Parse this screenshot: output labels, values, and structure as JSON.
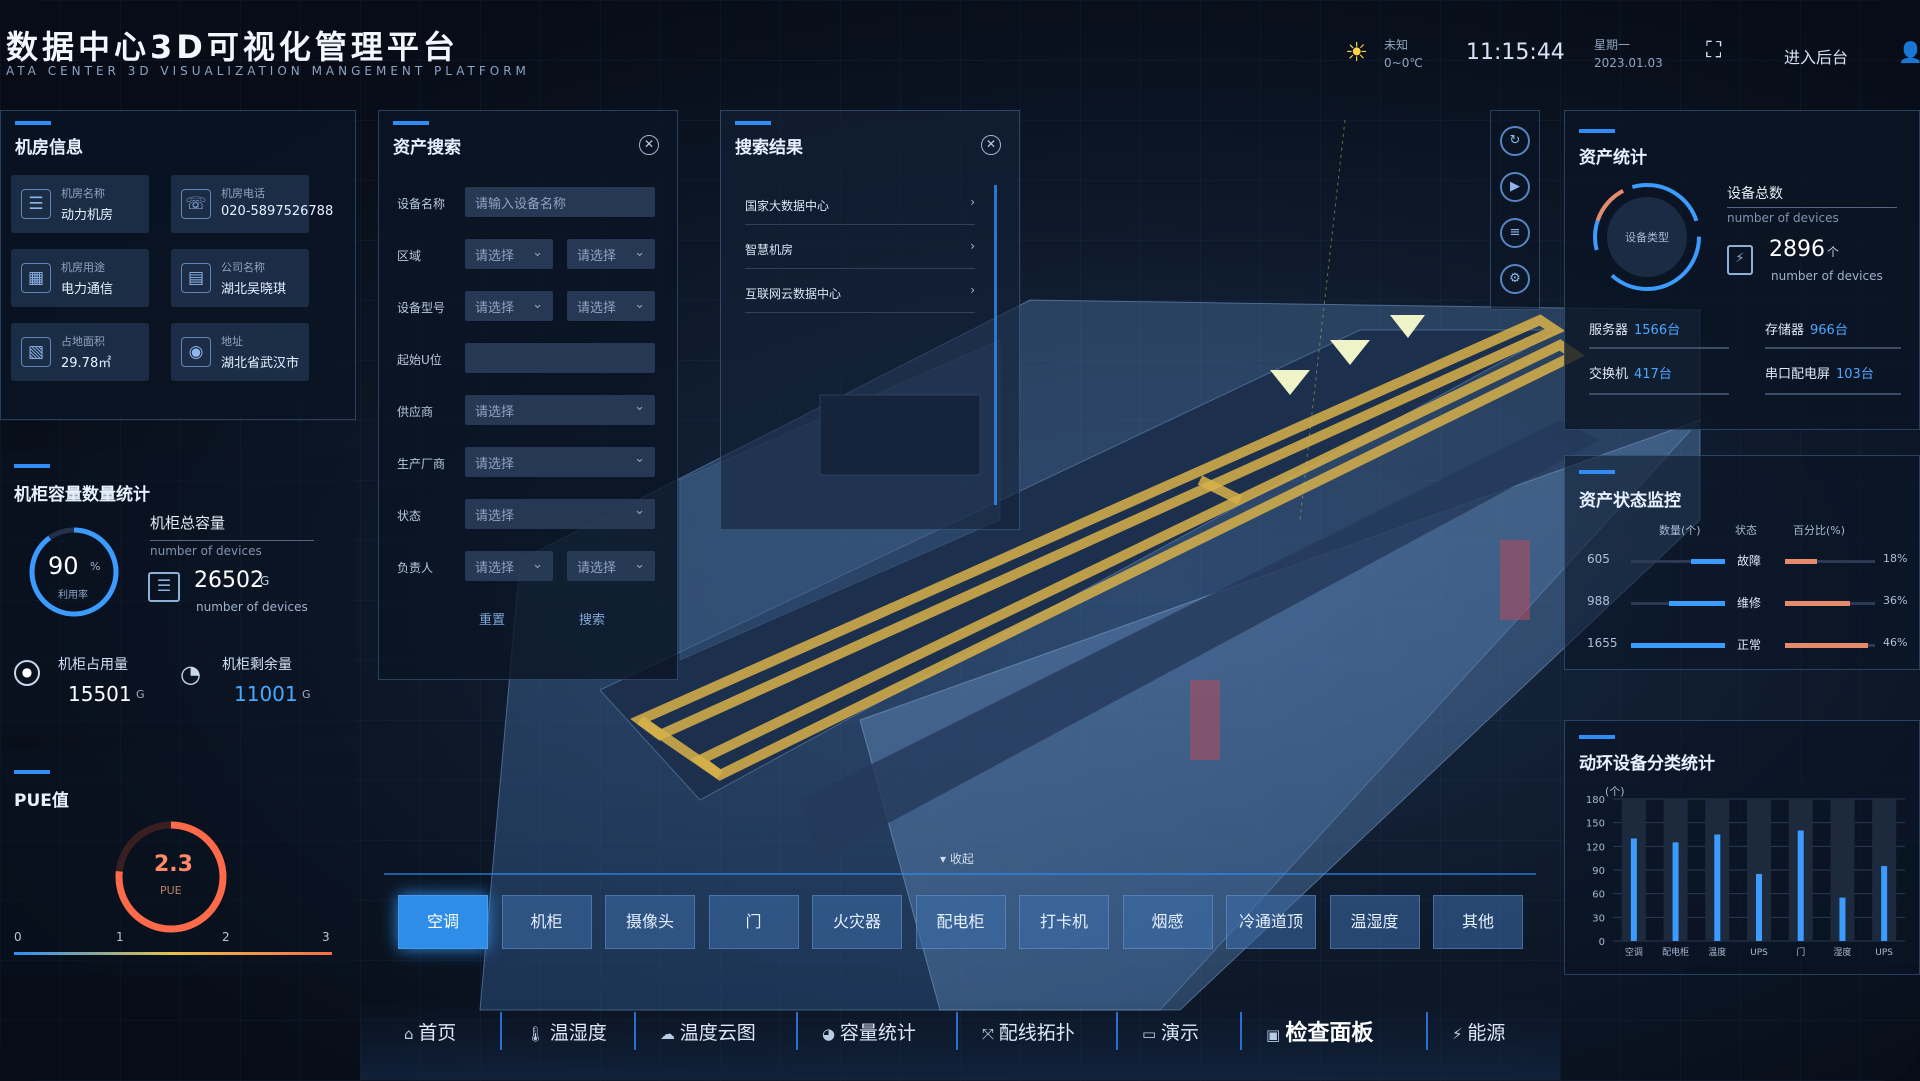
{
  "header": {
    "title": "数据中心3D可视化管理平台",
    "subtitle": "ATA CENTER 3D VISUALIZATION MANGEMENT PLATFORM",
    "weather": "未知",
    "temp": "0~0℃",
    "time": "11:15:44",
    "weekday": "星期一",
    "date": "2023.01.03",
    "enter_admin": "进入后台"
  },
  "room_info": {
    "title": "机房信息",
    "cards": [
      {
        "label": "机房名称",
        "value": "动力机房",
        "icon": "server-icon"
      },
      {
        "label": "机房电话",
        "value": "020-5897526788",
        "icon": "phone-icon"
      },
      {
        "label": "机房用途",
        "value": "电力通信",
        "icon": "grid-icon"
      },
      {
        "label": "公司名称",
        "value": "湖北吴晓琪",
        "icon": "building-icon"
      },
      {
        "label": "占地面积",
        "value": "29.78㎡",
        "icon": "area-icon"
      },
      {
        "label": "地址",
        "value": "湖北省武汉市",
        "icon": "location-icon"
      }
    ]
  },
  "cabinet_stats": {
    "title": "机柜容量数量统计",
    "gauge_value": "90",
    "gauge_unit": "%",
    "gauge_label": "利用率",
    "total_label": "机柜总容量",
    "total_sub": "number of devices",
    "total_value": "26502",
    "total_unit": "G",
    "total_value_sub": "number of devices",
    "used_label": "机柜占用量",
    "used_value": "15501",
    "used_unit": "G",
    "remain_label": "机柜剩余量",
    "remain_value": "11001",
    "remain_unit": "G"
  },
  "pue": {
    "title": "PUE值",
    "value": "2.3",
    "label": "PUE",
    "axis": [
      "0",
      "1",
      "2",
      "3"
    ]
  },
  "asset_search": {
    "title": "资产搜索",
    "fields": [
      {
        "label": "设备名称",
        "values": [
          "请输入设备名称"
        ]
      },
      {
        "label": "区域",
        "values": [
          "请选择",
          "请选择"
        ]
      },
      {
        "label": "设备型号",
        "values": [
          "请选择",
          "请选择"
        ]
      },
      {
        "label": "起始U位",
        "values": [
          ""
        ]
      },
      {
        "label": "供应商",
        "values": [
          "请选择"
        ]
      },
      {
        "label": "生产厂商",
        "values": [
          "请选择"
        ]
      },
      {
        "label": "状态",
        "values": [
          "请选择"
        ]
      },
      {
        "label": "负责人",
        "values": [
          "请选择",
          "请选择"
        ]
      }
    ],
    "reset": "重置",
    "search": "搜索"
  },
  "search_results": {
    "title": "搜索结果",
    "items": [
      "国家大数据中心",
      "智慧机房",
      "互联网云数据中心"
    ]
  },
  "asset_stats": {
    "title": "资产统计",
    "ring_label": "设备类型",
    "total_label": "设备总数",
    "total_sub": "number of devices",
    "total_value": "2896",
    "total_unit": "个",
    "total_value_sub": "number of devices",
    "items": [
      {
        "label": "服务器",
        "value": "1566台"
      },
      {
        "label": "存储器",
        "value": "966台"
      },
      {
        "label": "交换机",
        "value": "417台"
      },
      {
        "label": "串口配电屏",
        "value": "103台"
      }
    ]
  },
  "asset_status": {
    "title": "资产状态监控",
    "col_count": "数量(个)",
    "col_status": "状态",
    "col_pct": "百分比(%)",
    "rows": [
      {
        "count": "605",
        "status": "故障",
        "pct": "18%",
        "cval": 605,
        "pval": 18
      },
      {
        "count": "988",
        "status": "维修",
        "pct": "36%",
        "cval": 988,
        "pval": 36
      },
      {
        "count": "1655",
        "status": "正常",
        "pct": "46%",
        "cval": 1655,
        "pval": 46
      }
    ]
  },
  "env_stats": {
    "title": "动环设备分类统计",
    "unit": "(个)"
  },
  "chart_data": {
    "type": "bar",
    "title": "动环设备分类统计",
    "ylabel": "(个)",
    "ylim": [
      0,
      180
    ],
    "yticks": [
      "180",
      "150",
      "120",
      "90",
      "60",
      "30",
      "0"
    ],
    "categories": [
      "空调",
      "配电柜",
      "温度",
      "UPS",
      "门",
      "湿度",
      "UPS"
    ],
    "values": [
      130,
      125,
      135,
      85,
      140,
      55,
      95
    ],
    "values_right": [
      0,
      0,
      0,
      0,
      0,
      0,
      0
    ]
  },
  "collapse": "收起",
  "tabs": [
    "空调",
    "机柜",
    "摄像头",
    "门",
    "火灾器",
    "配电柜",
    "打卡机",
    "烟感",
    "冷通道顶",
    "温湿度",
    "其他"
  ],
  "nav": [
    {
      "label": "首页",
      "icon": "home-icon"
    },
    {
      "label": "温湿度",
      "icon": "thermometer-icon"
    },
    {
      "label": "温度云图",
      "icon": "cloud-icon"
    },
    {
      "label": "容量统计",
      "icon": "pie-icon"
    },
    {
      "label": "配线拓扑",
      "icon": "topology-icon"
    },
    {
      "label": "演示",
      "icon": "monitor-icon"
    },
    {
      "label": "检查面板",
      "icon": "panel-icon"
    },
    {
      "label": "能源",
      "icon": "bolt-icon"
    }
  ],
  "colors": {
    "accent": "#2f8df5",
    "gauge": "#3b9bff",
    "pue": "#ff6b4a",
    "tray": "#d8b24a"
  }
}
